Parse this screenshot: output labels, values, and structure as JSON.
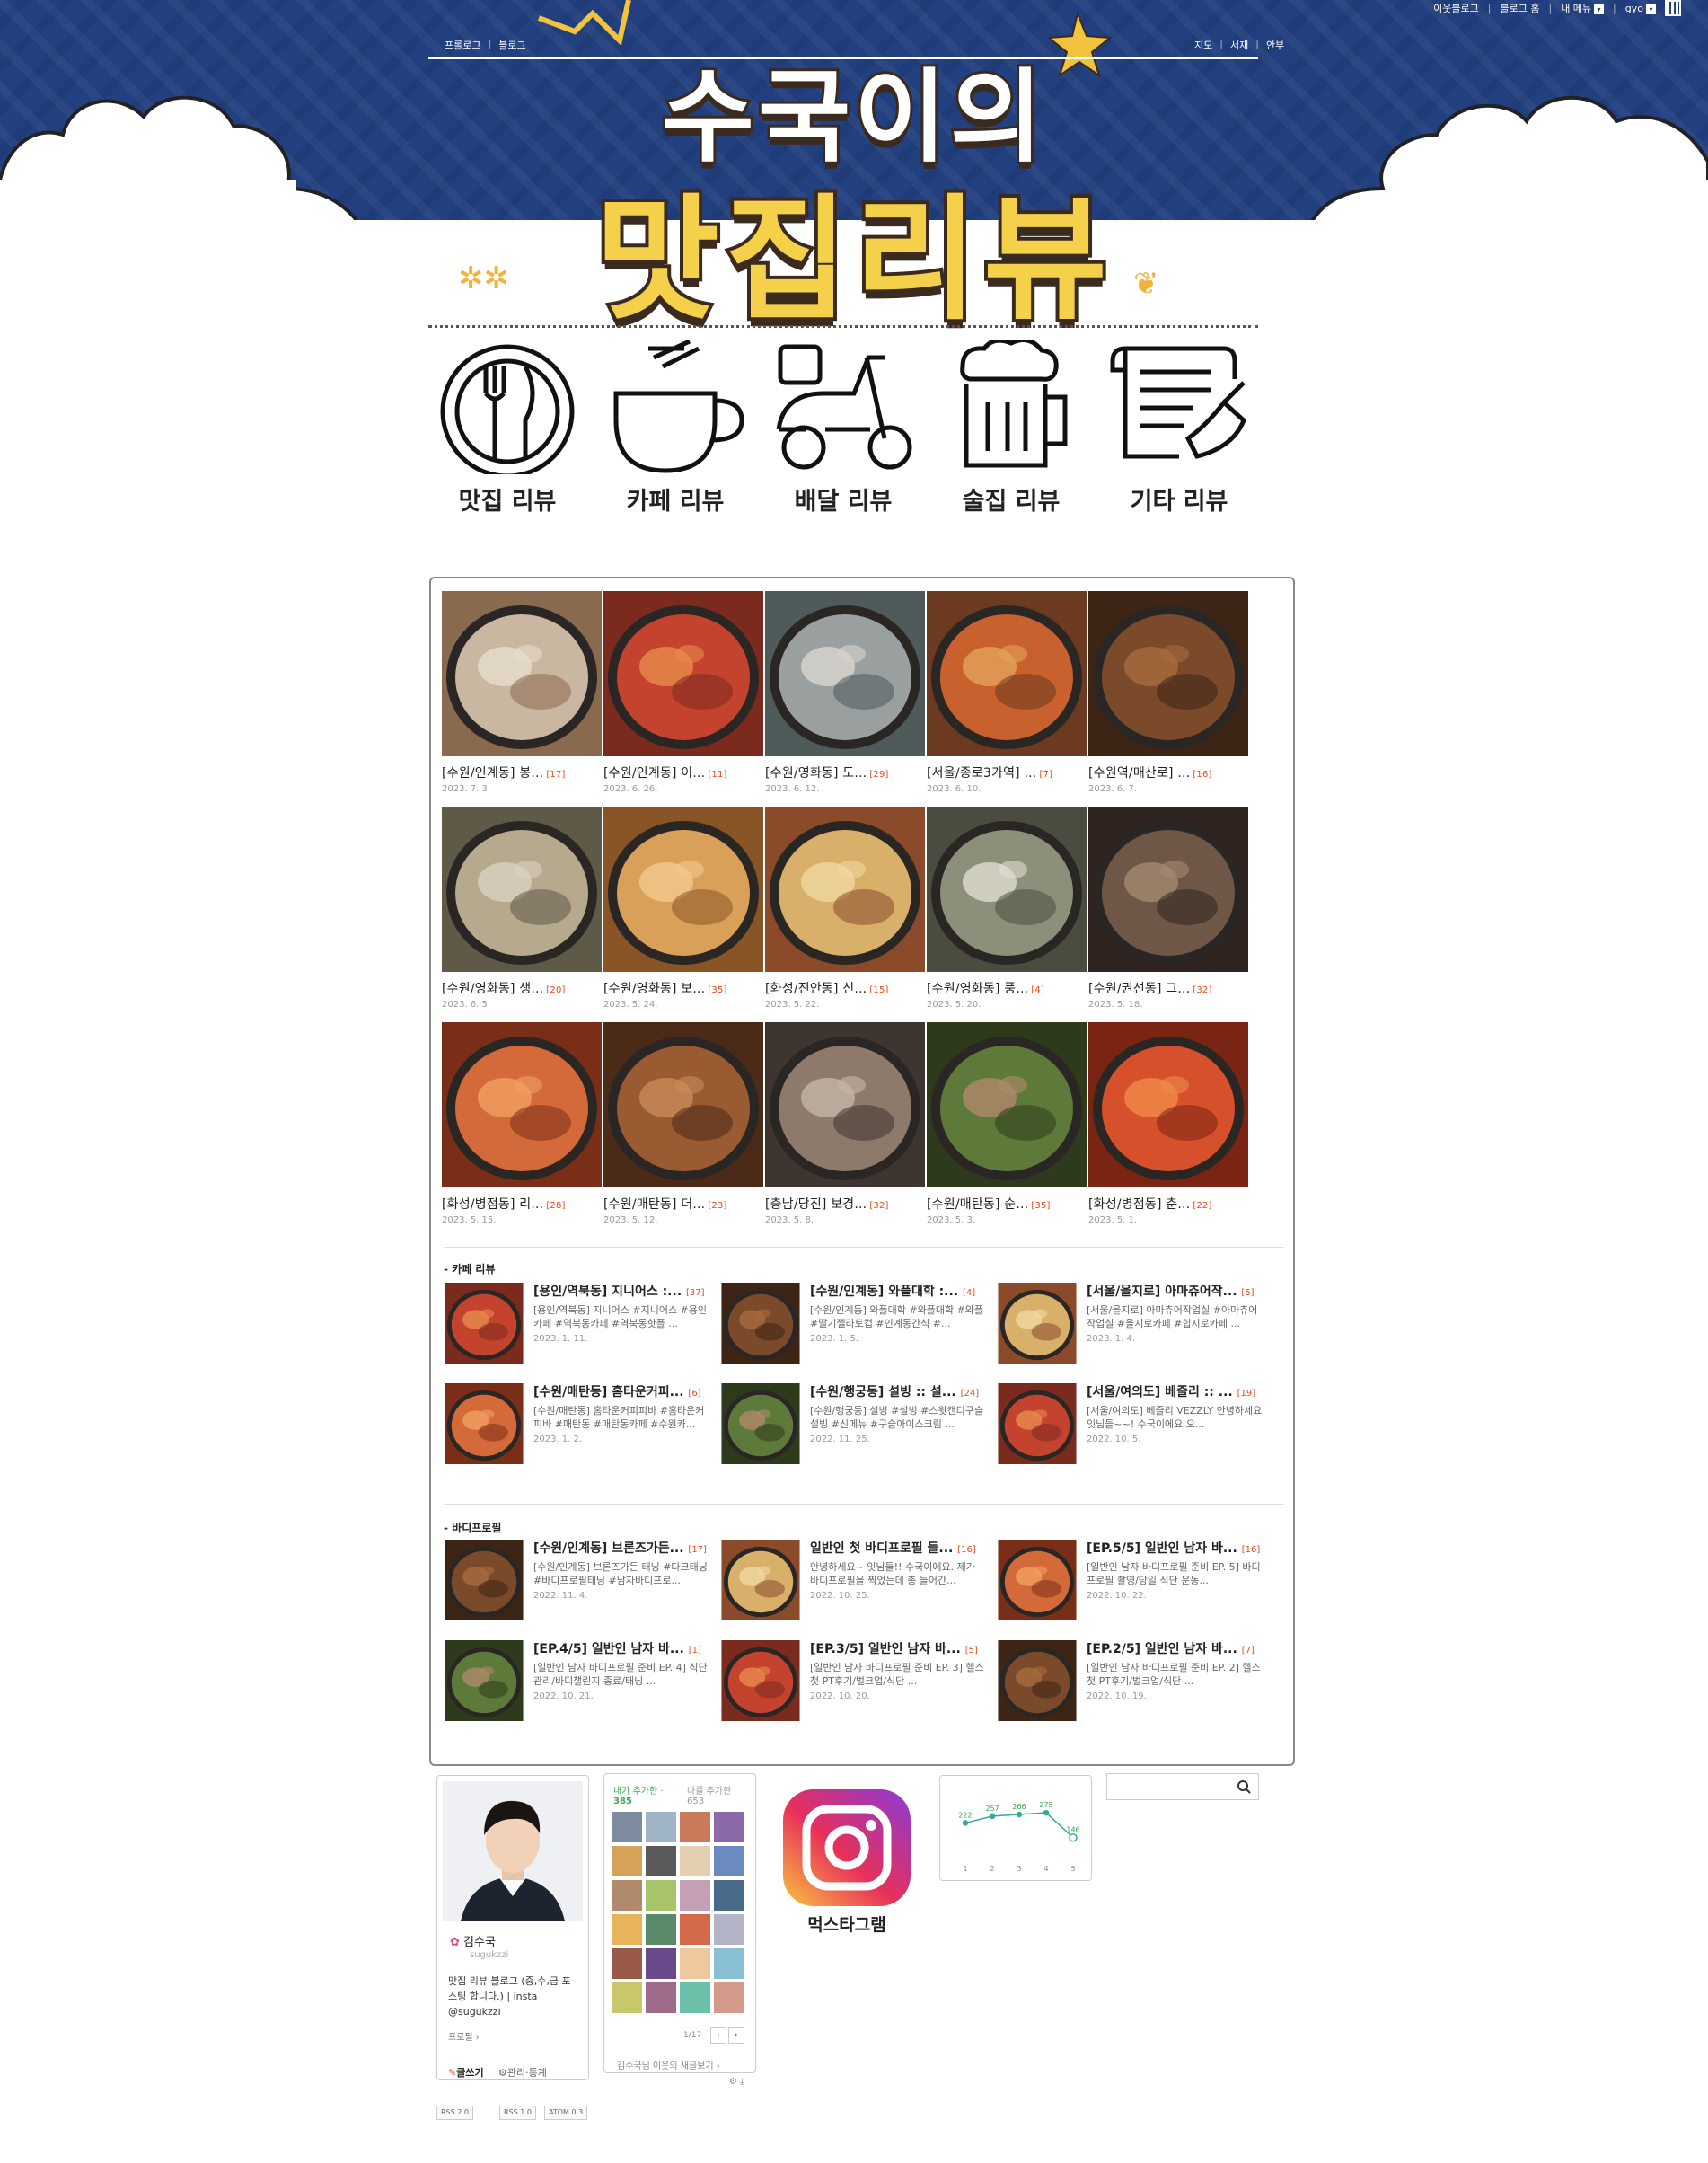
{
  "gnb": {
    "neighbor_blog": "이웃블로그",
    "blog_home": "블로그 홈",
    "my_menu": "내 메뉴",
    "user": "gyo"
  },
  "lnb": {
    "left": [
      "프롤로그",
      "블로그"
    ],
    "right": [
      "지도",
      "서재",
      "안부"
    ]
  },
  "blog_title": {
    "line1": "수국이의",
    "line2": "맛집리뷰"
  },
  "categories": [
    {
      "label": "맛집 리뷰"
    },
    {
      "label": "카페 리뷰"
    },
    {
      "label": "배달 리뷰"
    },
    {
      "label": "술집 리뷰"
    },
    {
      "label": "기타 리뷰"
    }
  ],
  "album": [
    {
      "title": "[수원/인계동] 봉...",
      "count": "[17]",
      "date": "2023. 7. 3."
    },
    {
      "title": "[수원/인계동] 이...",
      "count": "[11]",
      "date": "2023. 6. 26."
    },
    {
      "title": "[수원/영화동] 도...",
      "count": "[29]",
      "date": "2023. 6. 12."
    },
    {
      "title": "[서울/종로3가역] ...",
      "count": "[7]",
      "date": "2023. 6. 10."
    },
    {
      "title": "[수원역/매산로] ...",
      "count": "[16]",
      "date": "2023. 6. 7."
    },
    {
      "title": "[수원/영화동] 생...",
      "count": "[20]",
      "date": "2023. 6. 5."
    },
    {
      "title": "[수원/영화동] 보...",
      "count": "[35]",
      "date": "2023. 5. 24."
    },
    {
      "title": "[화성/진안동] 신...",
      "count": "[15]",
      "date": "2023. 5. 22."
    },
    {
      "title": "[수원/영화동] 풍...",
      "count": "[4]",
      "date": "2023. 5. 20."
    },
    {
      "title": "[수원/권선동] 그...",
      "count": "[32]",
      "date": "2023. 5. 18."
    },
    {
      "title": "[화성/병점동] 리...",
      "count": "[28]",
      "date": "2023. 5. 15."
    },
    {
      "title": "[수원/매탄동] 더...",
      "count": "[23]",
      "date": "2023. 5. 12."
    },
    {
      "title": "[충남/당진] 보경...",
      "count": "[32]",
      "date": "2023. 5. 8."
    },
    {
      "title": "[수원/매탄동] 순...",
      "count": "[35]",
      "date": "2023. 5. 3."
    },
    {
      "title": "[화성/병점동] 춘...",
      "count": "[22]",
      "date": "2023. 5. 1."
    }
  ],
  "cafe_section": {
    "title": "- 카페 리뷰",
    "posts": [
      {
        "title": "[용인/역북동] 지니어스 :...",
        "count": "[37]",
        "desc": "[용인/역북동] 지니어스 #지니어스 #용인카페 #역북동카페 #역북동핫플 ...",
        "date": "2023. 1. 11."
      },
      {
        "title": "[수원/인계동] 와플대학 :...",
        "count": "[4]",
        "desc": "[수원/인계동] 와플대학 #와플대학 #와플 #딸기젤라토컵 #인계동간식 #...",
        "date": "2023. 1. 5."
      },
      {
        "title": "[서울/을지로] 아마츄어작...",
        "count": "[5]",
        "desc": "[서울/을지로] 아마츄어작업실 #아마츄어작업실 #을지로카페 #힙지로카페 ...",
        "date": "2023. 1. 4."
      },
      {
        "title": "[수원/매탄동] 홈타운커피...",
        "count": "[6]",
        "desc": "[수원/매탄동] 홈타운커피피바 #홈타운커피바 #매탄동 #매탄동카페 #수원카...",
        "date": "2023. 1. 2."
      },
      {
        "title": "[수원/행궁동] 설빙 :: 설...",
        "count": "[24]",
        "desc": "[수원/행궁동] 설빙 #설빙 #스윗캔디구슬설빙 #신메뉴 #구슬아이스크림 ...",
        "date": "2022. 11. 25."
      },
      {
        "title": "[서울/여의도] 베즐리 :: ...",
        "count": "[19]",
        "desc": "[서울/여의도] 베즐리 VEZZLY 안녕하세요 잇님들~~! 수국이에요 오...",
        "date": "2022. 10. 5."
      }
    ]
  },
  "body_section": {
    "title": "- 바디프로필",
    "posts": [
      {
        "title": "[수원/인계동] 브론즈가든...",
        "count": "[17]",
        "desc": "[수원/인계동] 브론즈가든 태닝 #다크태닝 #바디프로필태닝 #남자바디프로...",
        "date": "2022. 11. 4."
      },
      {
        "title": "일반인 첫 바디프로필 들...",
        "count": "[16]",
        "desc": "안녕하세요~ 잇님들!! 수국이에요. 제가 바디프로필을 찍었는데 총 들어간...",
        "date": "2022. 10. 25."
      },
      {
        "title": "[EP.5/5] 일반인 남자 바...",
        "count": "[16]",
        "desc": "[일반인 남자 바디프로필 준비 EP. 5] 바디프로필 촬영/당일 식단 운동...",
        "date": "2022. 10. 22."
      },
      {
        "title": "[EP.4/5] 일반인 남자 바...",
        "count": "[1]",
        "desc": "[일반인 남자 바디프로필 준비 EP. 4] 식단관리/바디챌린지 종료/태닝 ...",
        "date": "2022. 10. 21."
      },
      {
        "title": "[EP.3/5] 일반인 남자 바...",
        "count": "[5]",
        "desc": "[일반인 남자 바디프로필 준비 EP. 3] 헬스 첫 PT후기/벌크업/식단 ...",
        "date": "2022. 10. 20."
      },
      {
        "title": "[EP.2/5] 일반인 남자 바...",
        "count": "[7]",
        "desc": "[일반인 남자 바디프로필 준비 EP. 2] 헬스 첫 PT후기/벌크업/식단 ...",
        "date": "2022. 10. 19."
      }
    ]
  },
  "profile": {
    "name": "김수국",
    "id": "sugukzzi",
    "desc": "맛집 리뷰 블로그 (중,수,금 포스팅 합니다.) | insta @sugukzzi",
    "link": "프로필",
    "write": "글쓰기",
    "admin": "관리·통계"
  },
  "rss": [
    "RSS 2.0",
    "RSS 1.0",
    "ATOM 0.3"
  ],
  "neighbors": {
    "tab_added": "내가 추가한 ·",
    "added_count": "385",
    "tab_added_me": "나를 추가한",
    "added_me_count": "653",
    "page": "1/17",
    "footer": "김수국님 이웃의 새글보기 ›"
  },
  "instagram": {
    "label": "먹스타그램"
  },
  "stats": {
    "values": [
      222,
      257,
      266,
      275,
      146
    ],
    "labels": [
      "1",
      "2",
      "3",
      "4",
      "5"
    ]
  },
  "colors": {
    "sky": "#22407f",
    "title_yellow": "#f5d04a",
    "count_red": "#e04b1f",
    "green": "#3aab50"
  }
}
